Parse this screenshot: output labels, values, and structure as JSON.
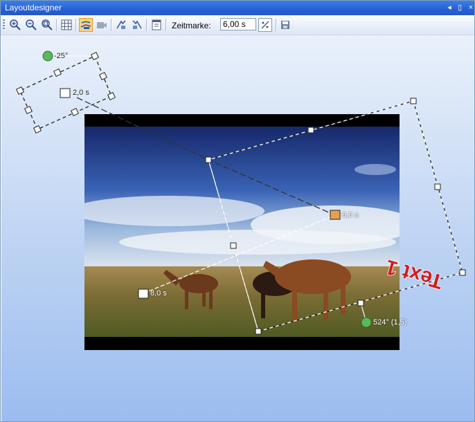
{
  "window": {
    "title": "Layoutdesigner",
    "pin_glyph": "◂ ⊥",
    "close_glyph": "×"
  },
  "toolbar": {
    "time_label": "Zeitmarke:",
    "time_value": "6,00 s",
    "tools": [
      "zoom-in-icon",
      "zoom-out-icon",
      "zoom-fit-icon",
      "grid-icon",
      "motion-path-icon",
      "camera-icon",
      "align-left-icon",
      "align-right-icon",
      "properties-icon"
    ]
  },
  "markers": {
    "small_rotation": "-25°",
    "small_keyframe": "2,0 s",
    "keyframe_mid": "6,0 s",
    "keyframe_left": "8,0 s",
    "big_rotation": "524° (1,5)"
  },
  "text_object": {
    "content": "Text 1",
    "color": "#cc1f1f"
  },
  "colors": {
    "accent": "#2760d4",
    "title_active": "#3d7ee6",
    "handle_rotate": "#5cb85c",
    "keyframe_active": "#e8a04c"
  }
}
